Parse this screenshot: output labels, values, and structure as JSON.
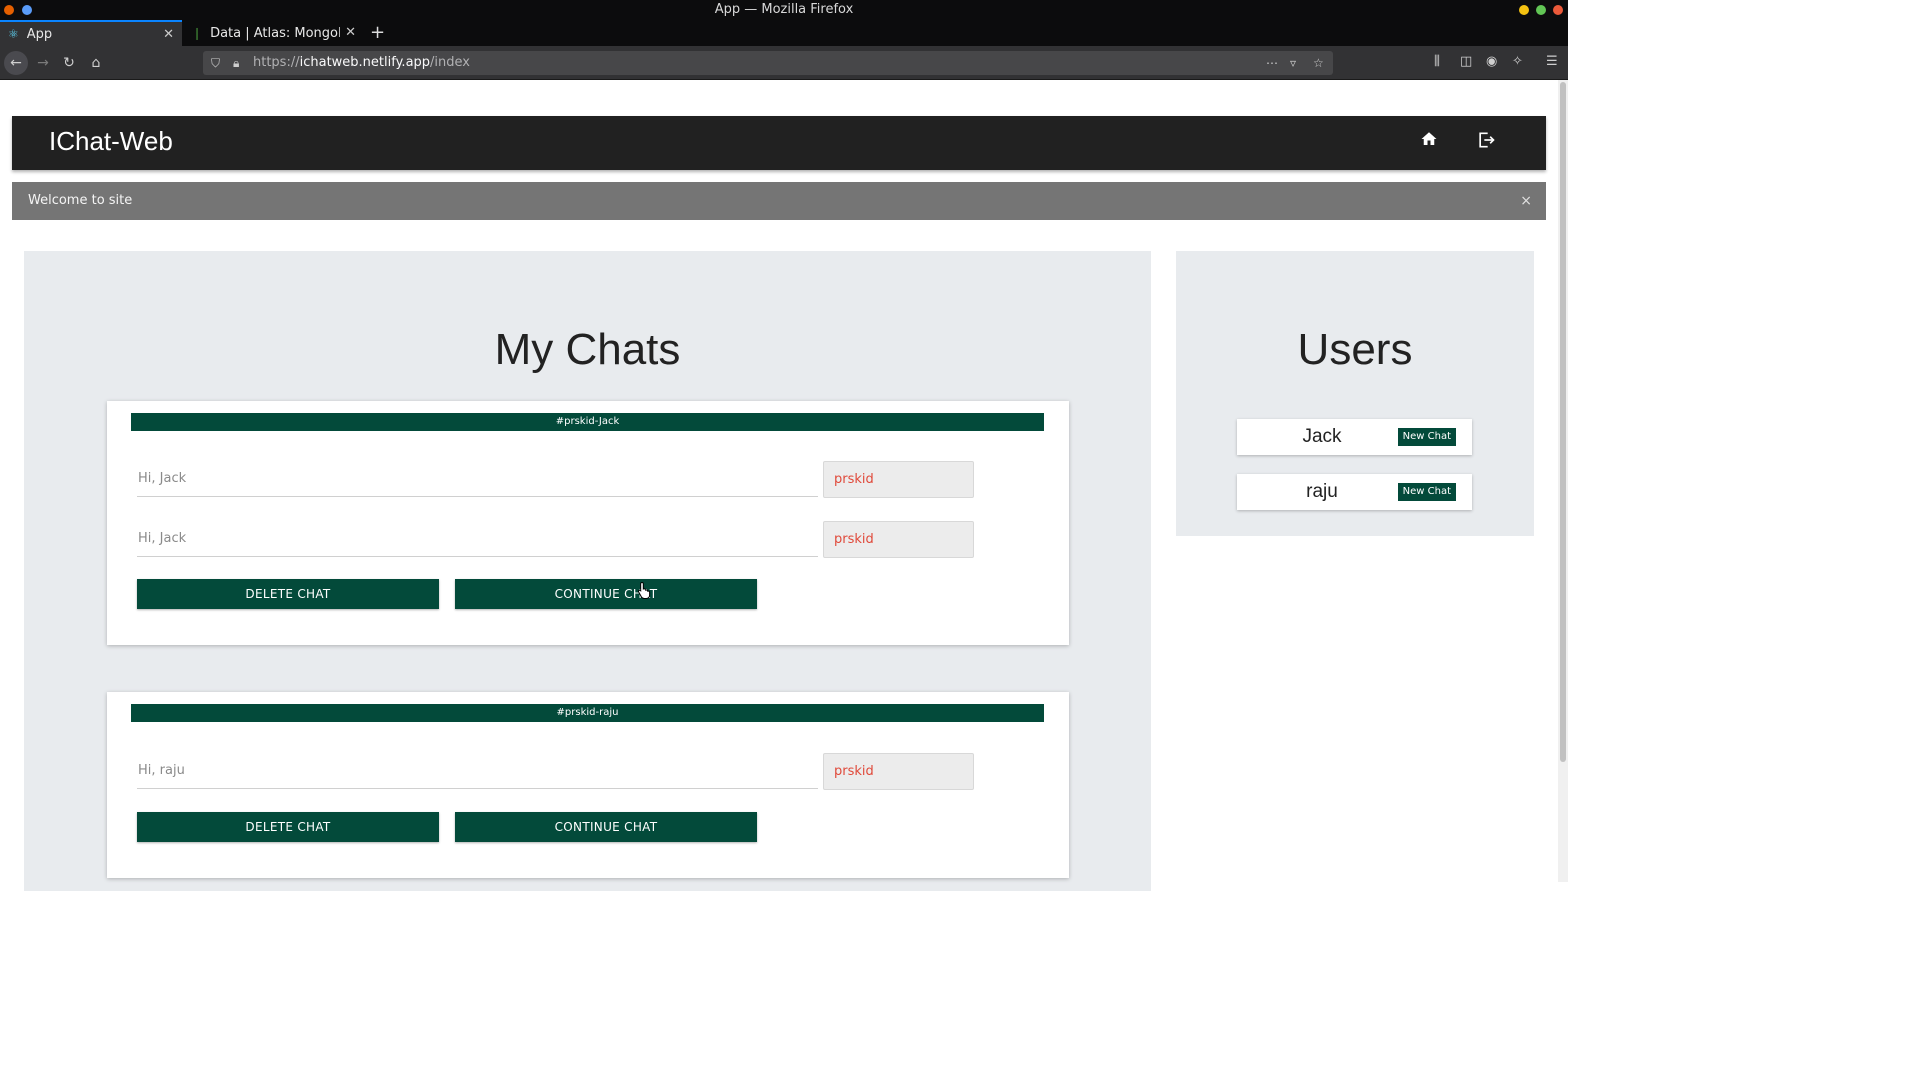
{
  "browser": {
    "window_title": "App — Mozilla Firefox",
    "tabs": [
      {
        "label": "App"
      },
      {
        "label": "Data | Atlas: MongoD"
      }
    ],
    "url": {
      "scheme": "https://",
      "host": "ichatweb.netlify.app",
      "path": "/index"
    }
  },
  "app": {
    "brand": "IChat-Web",
    "alert": "Welcome to site",
    "alert_close": "×"
  },
  "my_chats": {
    "title": "My Chats",
    "chats": [
      {
        "tag": "#prskid-Jack",
        "messages": [
          {
            "text": "Hi, Jack",
            "sender": "prskid"
          },
          {
            "text": "Hi, Jack",
            "sender": "prskid"
          }
        ],
        "delete_label": "DELETE CHAT",
        "continue_label": "CONTINUE CHAT"
      },
      {
        "tag": "#prskid-raju",
        "messages": [
          {
            "text": "Hi, raju",
            "sender": "prskid"
          }
        ],
        "delete_label": "DELETE CHAT",
        "continue_label": "CONTINUE CHAT"
      }
    ]
  },
  "users": {
    "title": "Users",
    "list": [
      {
        "name": "Jack",
        "action": "New Chat"
      },
      {
        "name": "raju",
        "action": "New Chat"
      }
    ]
  },
  "colors": {
    "accent": "#034a3a",
    "header": "#212121",
    "alert": "#757575",
    "sender": "#e0493a"
  }
}
